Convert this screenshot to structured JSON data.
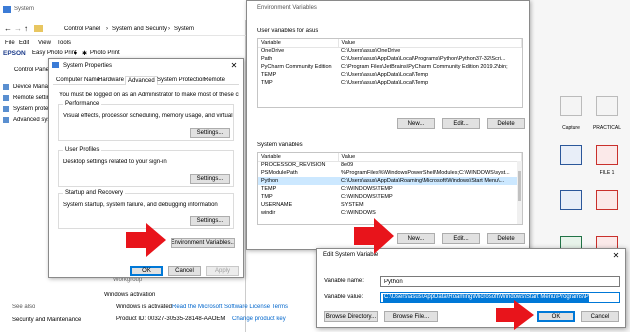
{
  "background_window": {
    "title": "System",
    "breadcrumb": [
      "Control Panel",
      "System and Security",
      "System"
    ],
    "menu": [
      "File",
      "Edit",
      "View",
      "Tools"
    ],
    "toolbar_brand": "EPSON",
    "toolbar_item1": "Easy Photo Print",
    "toolbar_item2": "Photo Print",
    "left_nav_home": "Control Panel Home",
    "left_nav": [
      "Device Manag",
      "Remote settin",
      "System protec",
      "Advanced syst"
    ],
    "see_also": "See also",
    "security_link": "Security and Maintenance",
    "activation_heading": "Windows activation",
    "activated_text": "Windows is activated",
    "license_link": "Read the Microsoft Software License Terms",
    "product_id": "Product ID: 00327-30535-28148-AAOEM",
    "change_key": "Change product key",
    "partial_label": "Workgroup"
  },
  "system_properties": {
    "title": "System Properties",
    "tabs": [
      "Computer Name",
      "Hardware",
      "Advanced",
      "System Protection",
      "Remote"
    ],
    "admin_note": "You must be logged on as an Administrator to make most of these changes.",
    "performance_title": "Performance",
    "performance_desc": "Visual effects, processor scheduling, memory usage, and virtual memory",
    "user_profiles_title": "User Profiles",
    "user_profiles_desc": "Desktop settings related to your sign-in",
    "startup_title": "Startup and Recovery",
    "startup_desc": "System startup, system failure, and debugging information",
    "settings_label": "Settings...",
    "env_vars_label": "Environment Variables...",
    "ok": "OK",
    "cancel": "Cancel",
    "apply": "Apply"
  },
  "env_vars": {
    "title": "Environment Variables",
    "user_section": "User variables for asus",
    "system_section": "System variables",
    "col_variable": "Variable",
    "col_value": "Value",
    "user_rows": [
      {
        "variable": "OneDrive",
        "value": "C:\\Users\\asus\\OneDrive"
      },
      {
        "variable": "Path",
        "value": "C:\\Users\\asus\\AppData\\Local\\Programs\\Python\\Python37-32\\Scri..."
      },
      {
        "variable": "PyCharm Community Edition",
        "value": "C:\\Program Files\\JetBrains\\PyCharm Community Edition 2019.2\\bin;"
      },
      {
        "variable": "TEMP",
        "value": "C:\\Users\\asus\\AppData\\Local\\Temp"
      },
      {
        "variable": "TMP",
        "value": "C:\\Users\\asus\\AppData\\Local\\Temp"
      }
    ],
    "system_rows": [
      {
        "variable": "PROCESSOR_REVISION",
        "value": "8e09"
      },
      {
        "variable": "PSModulePath",
        "value": "%ProgramFiles%\\WindowsPowerShell\\Modules;C:\\WINDOWS\\syst..."
      },
      {
        "variable": "Python",
        "value": "C:\\Users\\asus\\AppData\\Roaming\\Microsoft\\Windows\\Start Menu\\..."
      },
      {
        "variable": "TEMP",
        "value": "C:\\WINDOWS\\TEMP"
      },
      {
        "variable": "TMP",
        "value": "C:\\WINDOWS\\TEMP"
      },
      {
        "variable": "USERNAME",
        "value": "SYSTEM"
      },
      {
        "variable": "windir",
        "value": "C:\\WINDOWS"
      }
    ],
    "new_label": "New...",
    "edit_label": "Edit...",
    "delete_label": "Delete"
  },
  "edit_dialog": {
    "title": "Edit System Variable",
    "name_label": "Variable name:",
    "name_value": "Python",
    "value_label": "Variable value:",
    "value_value": "C:\\Users\\asus\\AppData\\Roaming\\Microsoft\\Windows\\Start Menu\\Programs\\Python 3.7",
    "browse_dir": "Browse Directory...",
    "browse_file": "Browse File...",
    "ok": "OK",
    "cancel": "Cancel"
  },
  "desktop_icons": [
    "Capture",
    "PRACTICAL",
    "FILE 1",
    "",
    "",
    "",
    "",
    ""
  ],
  "colors": {
    "arrow": "#e8141b",
    "selection": "#cce8ff",
    "accent": "#0078d7",
    "link": "#0066cc"
  }
}
